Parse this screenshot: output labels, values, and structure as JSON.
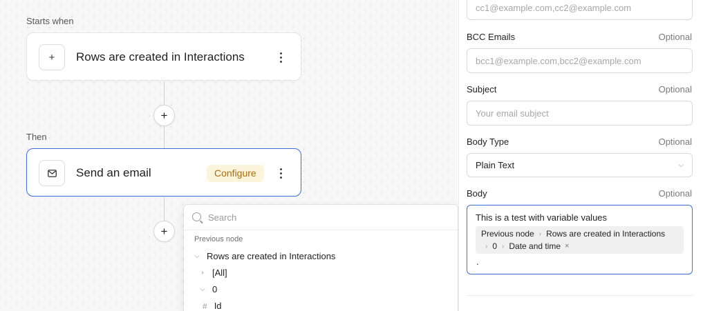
{
  "canvas": {
    "starts_when_label": "Starts when",
    "then_label": "Then",
    "trigger_node": {
      "title": "Rows are created in Interactions",
      "icon": "plus-icon"
    },
    "action_node": {
      "title": "Send an email",
      "icon": "mail-icon",
      "badge": "Configure"
    }
  },
  "dropdown": {
    "search_placeholder": "Search",
    "group_label": "Previous node",
    "items": [
      {
        "label": "Rows are created in Interactions",
        "expanded": true
      },
      {
        "label": "[All]",
        "expanded": false
      },
      {
        "label": "0",
        "expanded": true
      },
      {
        "label": "Id",
        "type": "number"
      }
    ]
  },
  "panel": {
    "cc": {
      "placeholder": "cc1@example.com,cc2@example.com"
    },
    "bcc": {
      "label": "BCC Emails",
      "optional": "Optional",
      "placeholder": "bcc1@example.com,bcc2@example.com"
    },
    "subject": {
      "label": "Subject",
      "optional": "Optional",
      "placeholder": "Your email subject"
    },
    "body_type": {
      "label": "Body Type",
      "optional": "Optional",
      "value": "Plain Text"
    },
    "body": {
      "label": "Body",
      "optional": "Optional",
      "text": "This is a test with variable values",
      "variable_path": [
        "Previous node",
        "Rows are created in Interactions",
        "0",
        "Date and time"
      ],
      "trailing_text": "."
    }
  },
  "colors": {
    "accent": "#3b6fe0",
    "badge_bg": "#fdf4dc",
    "badge_text": "#a66d0a"
  }
}
